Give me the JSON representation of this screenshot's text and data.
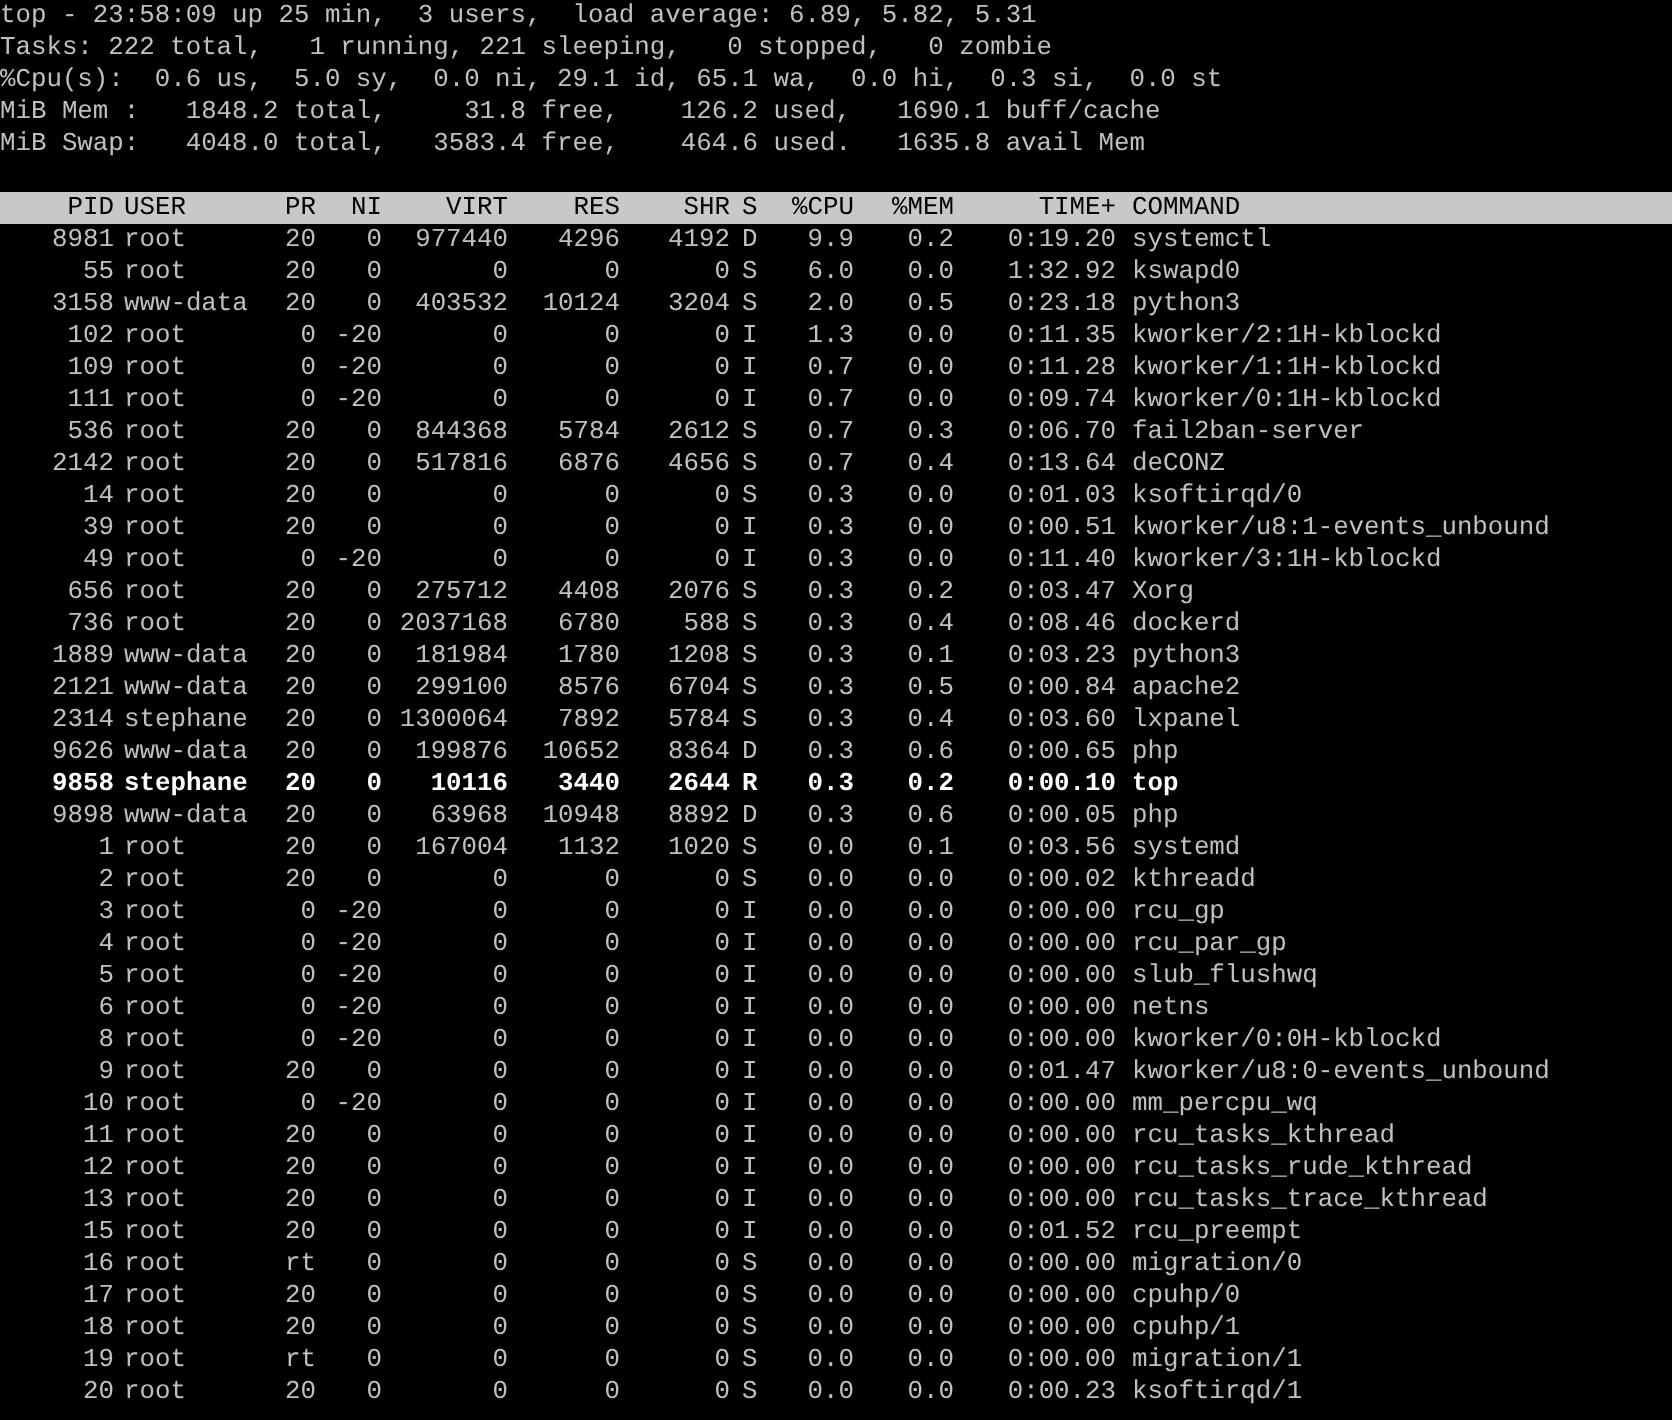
{
  "summary": [
    "top - 23:58:09 up 25 min,  3 users,  load average: 6.89, 5.82, 5.31",
    "Tasks: 222 total,   1 running, 221 sleeping,   0 stopped,   0 zombie",
    "%Cpu(s):  0.6 us,  5.0 sy,  0.0 ni, 29.1 id, 65.1 wa,  0.0 hi,  0.3 si,  0.0 st",
    "MiB Mem :   1848.2 total,     31.8 free,    126.2 used,   1690.1 buff/cache",
    "MiB Swap:   4048.0 total,   3583.4 free,    464.6 used.   1635.8 avail Mem"
  ],
  "table": {
    "columns": [
      "PID",
      "USER",
      "PR",
      "NI",
      "VIRT",
      "RES",
      "SHR",
      "S",
      "%CPU",
      "%MEM",
      "TIME+",
      "COMMAND"
    ],
    "rows": [
      {
        "cells": [
          "8981",
          "root",
          "20",
          "0",
          "977440",
          "4296",
          "4192",
          "D",
          "9.9",
          "0.2",
          "0:19.20",
          "systemctl"
        ],
        "highlighted": false
      },
      {
        "cells": [
          "55",
          "root",
          "20",
          "0",
          "0",
          "0",
          "0",
          "S",
          "6.0",
          "0.0",
          "1:32.92",
          "kswapd0"
        ],
        "highlighted": false
      },
      {
        "cells": [
          "3158",
          "www-data",
          "20",
          "0",
          "403532",
          "10124",
          "3204",
          "S",
          "2.0",
          "0.5",
          "0:23.18",
          "python3"
        ],
        "highlighted": false
      },
      {
        "cells": [
          "102",
          "root",
          "0",
          "-20",
          "0",
          "0",
          "0",
          "I",
          "1.3",
          "0.0",
          "0:11.35",
          "kworker/2:1H-kblockd"
        ],
        "highlighted": false
      },
      {
        "cells": [
          "109",
          "root",
          "0",
          "-20",
          "0",
          "0",
          "0",
          "I",
          "0.7",
          "0.0",
          "0:11.28",
          "kworker/1:1H-kblockd"
        ],
        "highlighted": false
      },
      {
        "cells": [
          "111",
          "root",
          "0",
          "-20",
          "0",
          "0",
          "0",
          "I",
          "0.7",
          "0.0",
          "0:09.74",
          "kworker/0:1H-kblockd"
        ],
        "highlighted": false
      },
      {
        "cells": [
          "536",
          "root",
          "20",
          "0",
          "844368",
          "5784",
          "2612",
          "S",
          "0.7",
          "0.3",
          "0:06.70",
          "fail2ban-server"
        ],
        "highlighted": false
      },
      {
        "cells": [
          "2142",
          "root",
          "20",
          "0",
          "517816",
          "6876",
          "4656",
          "S",
          "0.7",
          "0.4",
          "0:13.64",
          "deCONZ"
        ],
        "highlighted": false
      },
      {
        "cells": [
          "14",
          "root",
          "20",
          "0",
          "0",
          "0",
          "0",
          "S",
          "0.3",
          "0.0",
          "0:01.03",
          "ksoftirqd/0"
        ],
        "highlighted": false
      },
      {
        "cells": [
          "39",
          "root",
          "20",
          "0",
          "0",
          "0",
          "0",
          "I",
          "0.3",
          "0.0",
          "0:00.51",
          "kworker/u8:1-events_unbound"
        ],
        "highlighted": false
      },
      {
        "cells": [
          "49",
          "root",
          "0",
          "-20",
          "0",
          "0",
          "0",
          "I",
          "0.3",
          "0.0",
          "0:11.40",
          "kworker/3:1H-kblockd"
        ],
        "highlighted": false
      },
      {
        "cells": [
          "656",
          "root",
          "20",
          "0",
          "275712",
          "4408",
          "2076",
          "S",
          "0.3",
          "0.2",
          "0:03.47",
          "Xorg"
        ],
        "highlighted": false
      },
      {
        "cells": [
          "736",
          "root",
          "20",
          "0",
          "2037168",
          "6780",
          "588",
          "S",
          "0.3",
          "0.4",
          "0:08.46",
          "dockerd"
        ],
        "highlighted": false
      },
      {
        "cells": [
          "1889",
          "www-data",
          "20",
          "0",
          "181984",
          "1780",
          "1208",
          "S",
          "0.3",
          "0.1",
          "0:03.23",
          "python3"
        ],
        "highlighted": false
      },
      {
        "cells": [
          "2121",
          "www-data",
          "20",
          "0",
          "299100",
          "8576",
          "6704",
          "S",
          "0.3",
          "0.5",
          "0:00.84",
          "apache2"
        ],
        "highlighted": false
      },
      {
        "cells": [
          "2314",
          "stephane",
          "20",
          "0",
          "1300064",
          "7892",
          "5784",
          "S",
          "0.3",
          "0.4",
          "0:03.60",
          "lxpanel"
        ],
        "highlighted": false
      },
      {
        "cells": [
          "9626",
          "www-data",
          "20",
          "0",
          "199876",
          "10652",
          "8364",
          "D",
          "0.3",
          "0.6",
          "0:00.65",
          "php"
        ],
        "highlighted": false
      },
      {
        "cells": [
          "9858",
          "stephane",
          "20",
          "0",
          "10116",
          "3440",
          "2644",
          "R",
          "0.3",
          "0.2",
          "0:00.10",
          "top"
        ],
        "highlighted": true
      },
      {
        "cells": [
          "9898",
          "www-data",
          "20",
          "0",
          "63968",
          "10948",
          "8892",
          "D",
          "0.3",
          "0.6",
          "0:00.05",
          "php"
        ],
        "highlighted": false
      },
      {
        "cells": [
          "1",
          "root",
          "20",
          "0",
          "167004",
          "1132",
          "1020",
          "S",
          "0.0",
          "0.1",
          "0:03.56",
          "systemd"
        ],
        "highlighted": false
      },
      {
        "cells": [
          "2",
          "root",
          "20",
          "0",
          "0",
          "0",
          "0",
          "S",
          "0.0",
          "0.0",
          "0:00.02",
          "kthreadd"
        ],
        "highlighted": false
      },
      {
        "cells": [
          "3",
          "root",
          "0",
          "-20",
          "0",
          "0",
          "0",
          "I",
          "0.0",
          "0.0",
          "0:00.00",
          "rcu_gp"
        ],
        "highlighted": false
      },
      {
        "cells": [
          "4",
          "root",
          "0",
          "-20",
          "0",
          "0",
          "0",
          "I",
          "0.0",
          "0.0",
          "0:00.00",
          "rcu_par_gp"
        ],
        "highlighted": false
      },
      {
        "cells": [
          "5",
          "root",
          "0",
          "-20",
          "0",
          "0",
          "0",
          "I",
          "0.0",
          "0.0",
          "0:00.00",
          "slub_flushwq"
        ],
        "highlighted": false
      },
      {
        "cells": [
          "6",
          "root",
          "0",
          "-20",
          "0",
          "0",
          "0",
          "I",
          "0.0",
          "0.0",
          "0:00.00",
          "netns"
        ],
        "highlighted": false
      },
      {
        "cells": [
          "8",
          "root",
          "0",
          "-20",
          "0",
          "0",
          "0",
          "I",
          "0.0",
          "0.0",
          "0:00.00",
          "kworker/0:0H-kblockd"
        ],
        "highlighted": false
      },
      {
        "cells": [
          "9",
          "root",
          "20",
          "0",
          "0",
          "0",
          "0",
          "I",
          "0.0",
          "0.0",
          "0:01.47",
          "kworker/u8:0-events_unbound"
        ],
        "highlighted": false
      },
      {
        "cells": [
          "10",
          "root",
          "0",
          "-20",
          "0",
          "0",
          "0",
          "I",
          "0.0",
          "0.0",
          "0:00.00",
          "mm_percpu_wq"
        ],
        "highlighted": false
      },
      {
        "cells": [
          "11",
          "root",
          "20",
          "0",
          "0",
          "0",
          "0",
          "I",
          "0.0",
          "0.0",
          "0:00.00",
          "rcu_tasks_kthread"
        ],
        "highlighted": false
      },
      {
        "cells": [
          "12",
          "root",
          "20",
          "0",
          "0",
          "0",
          "0",
          "I",
          "0.0",
          "0.0",
          "0:00.00",
          "rcu_tasks_rude_kthread"
        ],
        "highlighted": false
      },
      {
        "cells": [
          "13",
          "root",
          "20",
          "0",
          "0",
          "0",
          "0",
          "I",
          "0.0",
          "0.0",
          "0:00.00",
          "rcu_tasks_trace_kthread"
        ],
        "highlighted": false
      },
      {
        "cells": [
          "15",
          "root",
          "20",
          "0",
          "0",
          "0",
          "0",
          "I",
          "0.0",
          "0.0",
          "0:01.52",
          "rcu_preempt"
        ],
        "highlighted": false
      },
      {
        "cells": [
          "16",
          "root",
          "rt",
          "0",
          "0",
          "0",
          "0",
          "S",
          "0.0",
          "0.0",
          "0:00.00",
          "migration/0"
        ],
        "highlighted": false
      },
      {
        "cells": [
          "17",
          "root",
          "20",
          "0",
          "0",
          "0",
          "0",
          "S",
          "0.0",
          "0.0",
          "0:00.00",
          "cpuhp/0"
        ],
        "highlighted": false
      },
      {
        "cells": [
          "18",
          "root",
          "20",
          "0",
          "0",
          "0",
          "0",
          "S",
          "0.0",
          "0.0",
          "0:00.00",
          "cpuhp/1"
        ],
        "highlighted": false
      },
      {
        "cells": [
          "19",
          "root",
          "rt",
          "0",
          "0",
          "0",
          "0",
          "S",
          "0.0",
          "0.0",
          "0:00.00",
          "migration/1"
        ],
        "highlighted": false
      },
      {
        "cells": [
          "20",
          "root",
          "20",
          "0",
          "0",
          "0",
          "0",
          "S",
          "0.0",
          "0.0",
          "0:00.23",
          "ksoftirqd/1"
        ],
        "highlighted": false
      }
    ]
  }
}
